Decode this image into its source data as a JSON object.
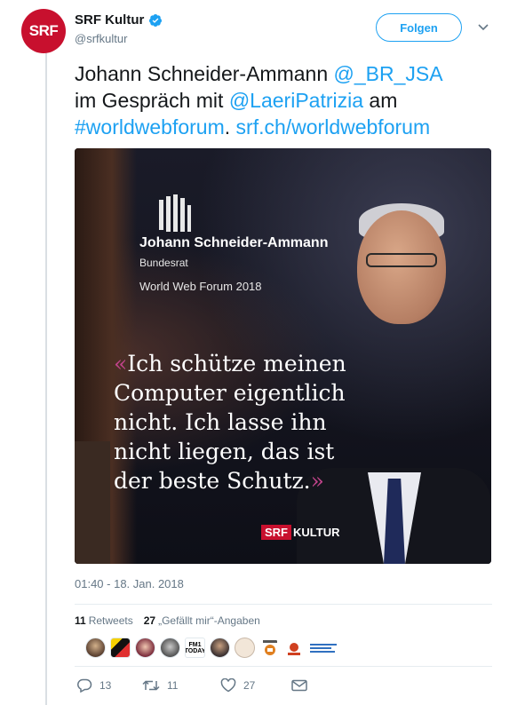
{
  "account": {
    "avatar_text": "SRF",
    "display_name": "SRF Kultur",
    "handle": "@srfkultur",
    "verified": true
  },
  "follow_button": {
    "label": "Folgen"
  },
  "tweet": {
    "text_parts": {
      "p1": "Johann Schneider-Ammann ",
      "mention1": "@_BR_JSA",
      "p2": "im Gespräch mit ",
      "mention2": "@LaeriPatrizia",
      "p3": " am",
      "hashtag": "#worldwebforum",
      "p4": ".  ",
      "url": "srf.ch/worldwebforum"
    },
    "timestamp": "01:40 - 18. Jan. 2018"
  },
  "media": {
    "guest_name": "Johann Schneider-Ammann",
    "guest_role": "Bundesrat",
    "event": "World Web Forum 2018",
    "quote_open": "«",
    "quote_close": "»",
    "quote_lines": [
      "Ich schütze meinen",
      "Computer eigentlich",
      "nicht. Ich lasse ihn",
      "nicht liegen, das ist",
      "der beste Schutz."
    ],
    "brand_srf": "SRF",
    "brand_kultur": "KULTUR"
  },
  "stats": {
    "retweets_count": "11",
    "retweets_label": "Retweets",
    "likes_count": "27",
    "likes_label": "„Gefällt mir“-Angaben"
  },
  "liker_avatar_fm": "FM1\nTODAY",
  "actions": {
    "reply_count": "13",
    "retweet_count": "11",
    "like_count": "27"
  },
  "colors": {
    "link": "#1da1f2",
    "srf_red": "#c8102e",
    "quote_mark": "#c0438a",
    "muted": "#657786"
  }
}
